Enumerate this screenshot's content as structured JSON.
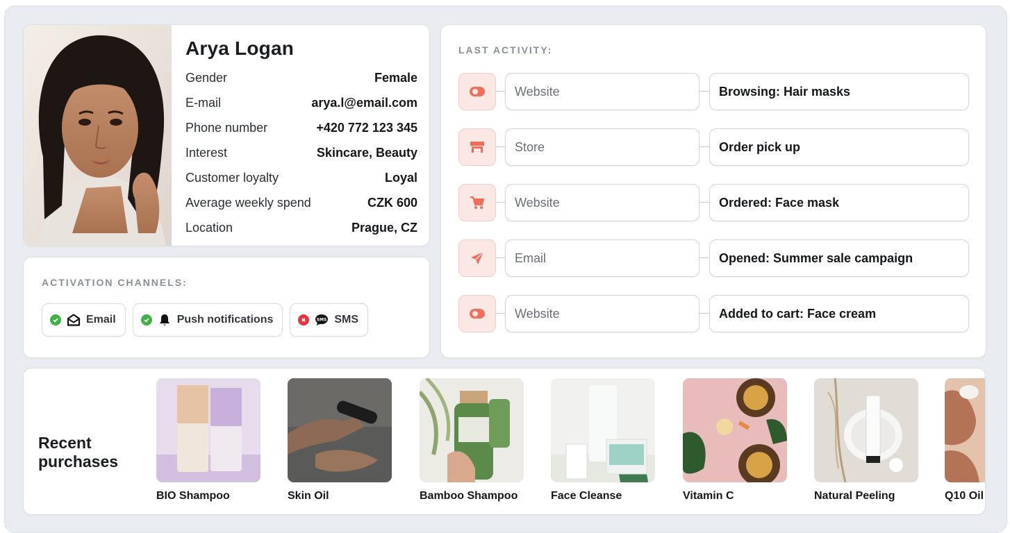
{
  "profile": {
    "name": "Arya Logan",
    "fields": [
      {
        "label": "Gender",
        "value": "Female"
      },
      {
        "label": "E-mail",
        "value": "arya.l@email.com"
      },
      {
        "label": "Phone number",
        "value": "+420 772 123 345"
      },
      {
        "label": "Interest",
        "value": "Skincare, Beauty"
      },
      {
        "label": "Customer loyalty",
        "value": "Loyal"
      },
      {
        "label": "Average weekly spend",
        "value": "CZK 600"
      },
      {
        "label": "Location",
        "value": "Prague, CZ"
      }
    ]
  },
  "activation": {
    "title": "ACTIVATION CHANNELS:",
    "channels": [
      {
        "label": "Email",
        "status": "enabled",
        "icon": "envelope-open-icon"
      },
      {
        "label": "Push notifications",
        "status": "enabled",
        "icon": "bell-icon"
      },
      {
        "label": "SMS",
        "status": "disabled",
        "icon": "sms-bubble-icon"
      }
    ]
  },
  "activity": {
    "title": "LAST ACTIVITY:",
    "items": [
      {
        "icon": "toggle-icon",
        "channel": "Website",
        "event": "Browsing: Hair masks"
      },
      {
        "icon": "store-icon",
        "channel": "Store",
        "event": "Order pick up"
      },
      {
        "icon": "cart-icon",
        "channel": "Website",
        "event": "Ordered: Face mask"
      },
      {
        "icon": "paper-plane-icon",
        "channel": "Email",
        "event": "Opened: Summer sale campaign"
      },
      {
        "icon": "toggle-icon",
        "channel": "Website",
        "event": "Added to cart: Face cream"
      }
    ]
  },
  "purchases": {
    "title": "Recent purchases",
    "items": [
      {
        "name": "BIO Shampoo"
      },
      {
        "name": "Skin Oil"
      },
      {
        "name": "Bamboo Shampoo"
      },
      {
        "name": "Face Cleanse"
      },
      {
        "name": "Vitamin C"
      },
      {
        "name": "Natural Peeling"
      },
      {
        "name": "Q10 Oil"
      }
    ]
  },
  "colors": {
    "accent": "#ee6f5c",
    "accent_bg": "#fbe7e4",
    "enabled": "#43b048",
    "disabled": "#e3353e"
  }
}
